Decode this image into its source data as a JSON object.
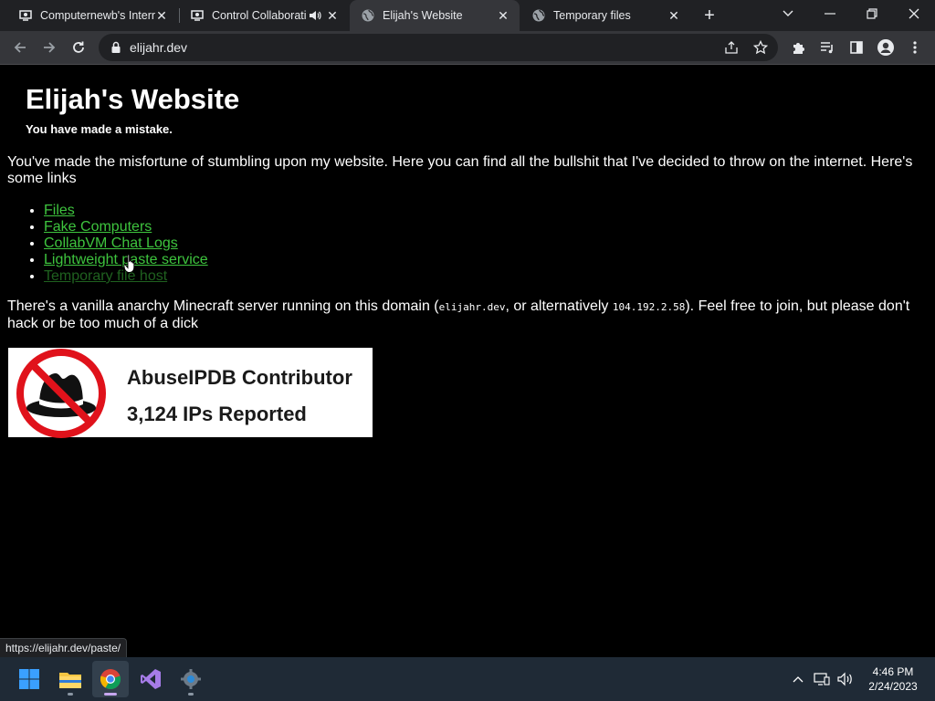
{
  "tabs": [
    {
      "title": "Computernewb's Intern",
      "icon": "collabvm-icon",
      "active": false
    },
    {
      "title": "Control Collaborati",
      "icon": "collabvm-icon",
      "active": false,
      "audio": true
    },
    {
      "title": "Elijah's Website",
      "icon": "globe-icon",
      "active": true
    },
    {
      "title": "Temporary files",
      "icon": "globe-icon",
      "active": false
    }
  ],
  "omnibox": {
    "url": "elijahr.dev"
  },
  "page": {
    "title": "Elijah's Website",
    "subtitle": "You have made a mistake.",
    "intro": "You've made the misfortune of stumbling upon my website. Here you can find all the bullshit that I've decided to throw on the internet. Here's some links",
    "links": [
      {
        "label": "Files"
      },
      {
        "label": "Fake Computers"
      },
      {
        "label": "CollabVM Chat Logs"
      },
      {
        "label": "Lightweight paste service"
      },
      {
        "label": "Temporary file host"
      }
    ],
    "minecraft": {
      "before": "There's a vanilla anarchy Minecraft server running on this domain (",
      "domain": "elijahr.dev",
      "middle": ", or alternatively ",
      "ip": "104.192.2.58",
      "after": "). Feel free to join, but please don't hack or be too much of a dick"
    },
    "badge": {
      "line1": "AbuseIPDB Contributor",
      "line2": "3,124 IPs Reported"
    }
  },
  "status_bar": {
    "url": "https://elijahr.dev/paste/"
  },
  "taskbar": {
    "apps": [
      "start-button",
      "file-explorer",
      "chrome",
      "visual-studio",
      "settings"
    ],
    "clock": {
      "time": "4:46 PM",
      "date": "2/24/2023"
    }
  },
  "colors": {
    "link": "#3ec43e",
    "tab_strip": "#202124",
    "toolbar": "#35363a",
    "taskbar": "#1f2a36"
  }
}
